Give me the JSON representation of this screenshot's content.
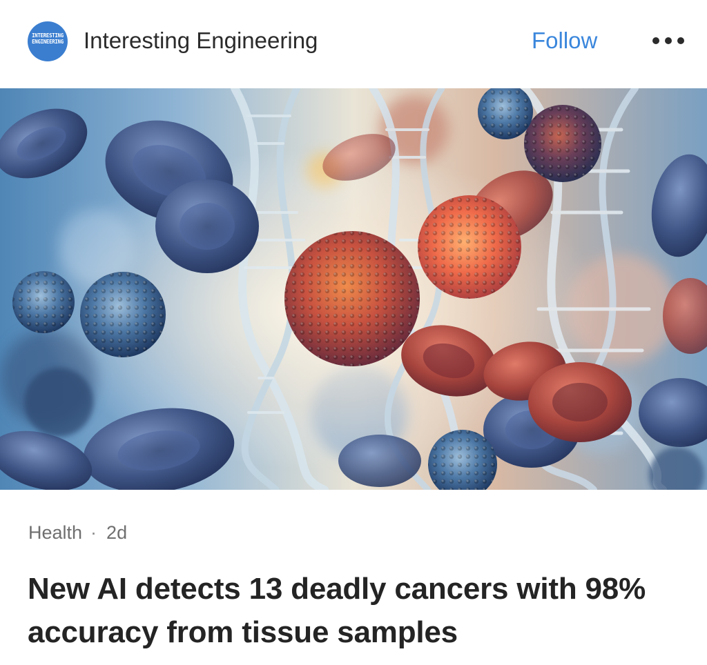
{
  "header": {
    "avatar_line1": "INTERESTING",
    "avatar_line2": "ENGINEERING",
    "publisher_name": "Interesting Engineering",
    "follow_label": "Follow"
  },
  "article": {
    "category": "Health",
    "separator": "·",
    "age": "2d",
    "headline": "New AI detects 13 deadly cancers with 98% accuracy from tissue samples"
  },
  "icons": {
    "more": "more-horizontal-icon"
  },
  "colors": {
    "follow_accent": "#3a86dc",
    "avatar_bg": "#3b7ed0",
    "meta_text": "#6f6f6f",
    "headline_text": "#242424"
  }
}
